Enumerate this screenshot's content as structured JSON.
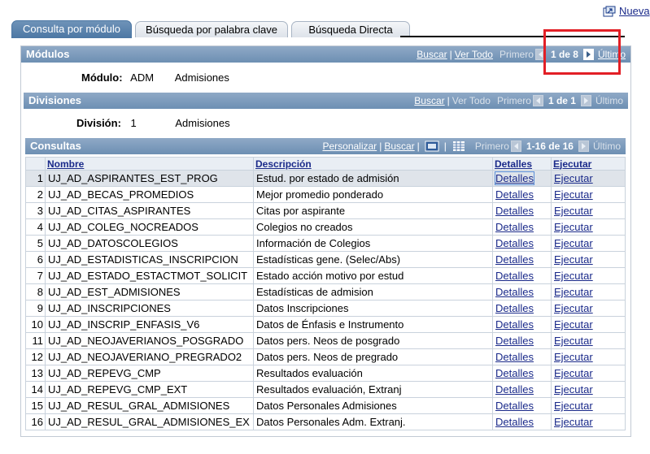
{
  "top_link": {
    "label": "Nueva"
  },
  "tabs": [
    {
      "label": "Consulta por módulo",
      "active": true
    },
    {
      "label": "Búsqueda por palabra clave",
      "active": false
    },
    {
      "label": "Búsqueda Directa",
      "active": false
    }
  ],
  "modulos": {
    "title": "Módulos",
    "nav": {
      "buscar": "Buscar",
      "ver_todo": "Ver Todo",
      "primero": "Primero",
      "count": "1 de 8",
      "ultimo": "Último"
    },
    "label": "Módulo:",
    "code": "ADM",
    "name": "Admisiones"
  },
  "divisiones": {
    "title": "Divisiones",
    "nav": {
      "buscar": "Buscar",
      "ver_todo": "Ver Todo",
      "primero": "Primero",
      "count": "1 de 1",
      "ultimo": "Último"
    },
    "label": "División:",
    "code": "1",
    "name": "Admisiones"
  },
  "consultas": {
    "title": "Consultas",
    "nav": {
      "personalizar": "Personalizar",
      "buscar": "Buscar",
      "primero": "Primero",
      "count": "1-16 de 16",
      "ultimo": "Último"
    },
    "headers": {
      "nombre": "Nombre",
      "descripcion": "Descripción",
      "detalles": "Detalles",
      "ejecutar": "Ejecutar"
    },
    "rows": [
      {
        "n": "1",
        "nombre": "UJ_AD_ASPIRANTES_EST_PROG",
        "descripcion": "Estud. por estado de admisión",
        "detalles": "Detalles",
        "ejecutar": "Ejecutar"
      },
      {
        "n": "2",
        "nombre": "UJ_AD_BECAS_PROMEDIOS",
        "descripcion": "Mejor promedio ponderado",
        "detalles": "Detalles",
        "ejecutar": "Ejecutar"
      },
      {
        "n": "3",
        "nombre": "UJ_AD_CITAS_ASPIRANTES",
        "descripcion": "Citas por aspirante",
        "detalles": "Detalles",
        "ejecutar": "Ejecutar"
      },
      {
        "n": "4",
        "nombre": "UJ_AD_COLEG_NOCREADOS",
        "descripcion": "Colegios no creados",
        "detalles": "Detalles",
        "ejecutar": "Ejecutar"
      },
      {
        "n": "5",
        "nombre": "UJ_AD_DATOSCOLEGIOS",
        "descripcion": "Información de Colegios",
        "detalles": "Detalles",
        "ejecutar": "Ejecutar"
      },
      {
        "n": "6",
        "nombre": "UJ_AD_ESTADISTICAS_INSCRIPCION",
        "descripcion": "Estadísticas gene. (Selec/Abs)",
        "detalles": "Detalles",
        "ejecutar": "Ejecutar"
      },
      {
        "n": "7",
        "nombre": "UJ_AD_ESTADO_ESTACTMOT_SOLICIT",
        "descripcion": "Estado acción motivo por estud",
        "detalles": "Detalles",
        "ejecutar": "Ejecutar"
      },
      {
        "n": "8",
        "nombre": "UJ_AD_EST_ADMISIONES",
        "descripcion": "Estadísticas de admision",
        "detalles": "Detalles",
        "ejecutar": "Ejecutar"
      },
      {
        "n": "9",
        "nombre": "UJ_AD_INSCRIPCIONES",
        "descripcion": "Datos Inscripciones",
        "detalles": "Detalles",
        "ejecutar": "Ejecutar"
      },
      {
        "n": "10",
        "nombre": "UJ_AD_INSCRIP_ENFASIS_V6",
        "descripcion": "Datos de Énfasis e Instrumento",
        "detalles": "Detalles",
        "ejecutar": "Ejecutar"
      },
      {
        "n": "11",
        "nombre": "UJ_AD_NEOJAVERIANOS_POSGRADO",
        "descripcion": "Datos pers. Neos de posgrado",
        "detalles": "Detalles",
        "ejecutar": "Ejecutar"
      },
      {
        "n": "12",
        "nombre": "UJ_AD_NEOJAVERIANO_PREGRADO2",
        "descripcion": "Datos pers. Neos de pregrado",
        "detalles": "Detalles",
        "ejecutar": "Ejecutar"
      },
      {
        "n": "13",
        "nombre": "UJ_AD_REPEVG_CMP",
        "descripcion": "Resultados evaluación",
        "detalles": "Detalles",
        "ejecutar": "Ejecutar"
      },
      {
        "n": "14",
        "nombre": "UJ_AD_REPEVG_CMP_EXT",
        "descripcion": "Resultados evaluación, Extranj",
        "detalles": "Detalles",
        "ejecutar": "Ejecutar"
      },
      {
        "n": "15",
        "nombre": "UJ_AD_RESUL_GRAL_ADMISIONES",
        "descripcion": "Datos Personales Admisiones",
        "detalles": "Detalles",
        "ejecutar": "Ejecutar"
      },
      {
        "n": "16",
        "nombre": "UJ_AD_RESUL_GRAL_ADMISIONES_EX",
        "descripcion": "Datos Personales Adm. Extranj.",
        "detalles": "Detalles",
        "ejecutar": "Ejecutar"
      }
    ]
  },
  "colors": {
    "bar": "#7d9cbd",
    "link": "#1a2a8a",
    "highlight": "#e21f26",
    "selected_row": "#dfe4ea"
  }
}
